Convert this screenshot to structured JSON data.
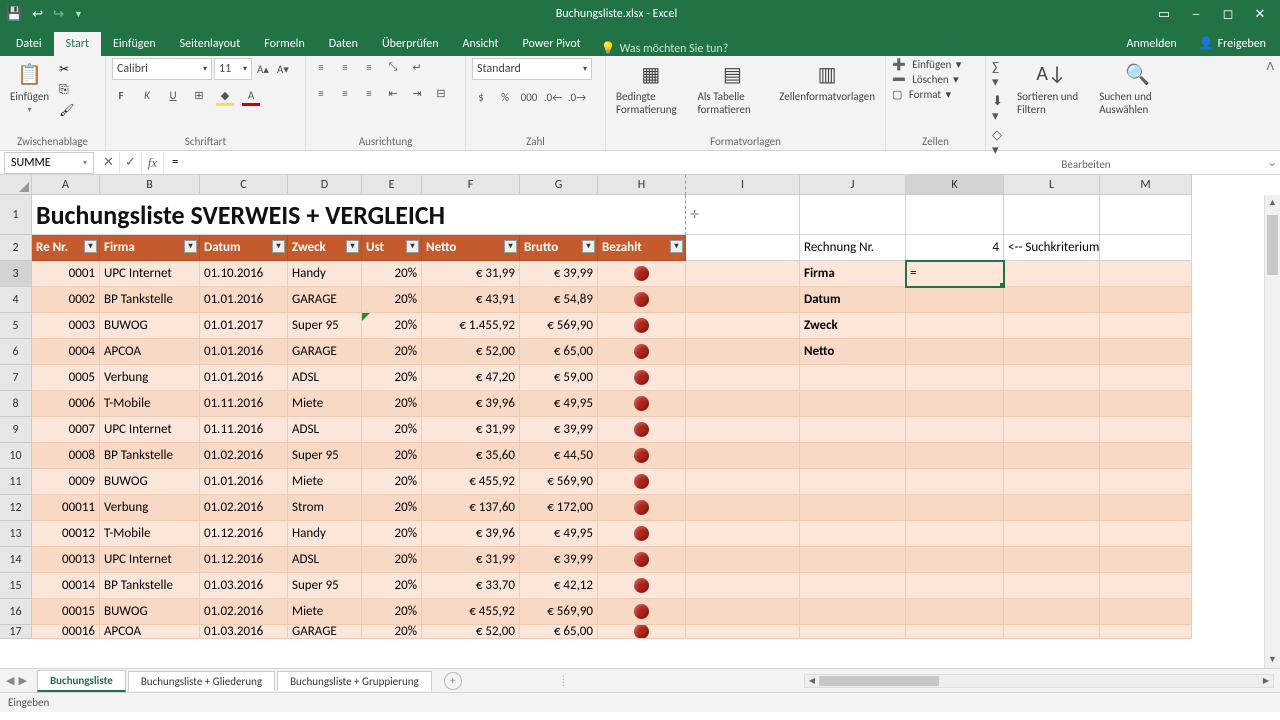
{
  "titlebar": {
    "title": "Buchungsliste.xlsx - Excel"
  },
  "tabs": {
    "file": "Datei",
    "t0": "Start",
    "t1": "Einfügen",
    "t2": "Seitenlayout",
    "t3": "Formeln",
    "t4": "Daten",
    "t5": "Überprüfen",
    "t6": "Ansicht",
    "t7": "Power Pivot",
    "tell": "Was möchten Sie tun?",
    "signin": "Anmelden",
    "share": "Freigeben"
  },
  "ribbon": {
    "clipboard": "Zwischenablage",
    "paste": "Einfügen",
    "font_group": "Schriftart",
    "font": "Calibri",
    "size": "11",
    "align": "Ausrichtung",
    "number": "Zahl",
    "numfmt": "Standard",
    "styles": "Formatvorlagen",
    "cond": "Bedingte Formatierung",
    "astable": "Als Tabelle formatieren",
    "cellstyles": "Zellenformatvorlagen",
    "cells": "Zellen",
    "insert": "Einfügen",
    "delete": "Löschen",
    "format": "Format",
    "editing": "Bearbeiten",
    "sortfilter": "Sortieren und Filtern",
    "findselect": "Suchen und Auswählen"
  },
  "fbar": {
    "name": "SUMME",
    "formula": "="
  },
  "cols": {
    "A": "A",
    "B": "B",
    "C": "C",
    "D": "D",
    "E": "E",
    "F": "F",
    "G": "G",
    "H": "H",
    "I": "I",
    "J": "J",
    "K": "K",
    "L": "L",
    "M": "M"
  },
  "sheet_title": "Buchungsliste SVERWEIS + VERGLEICH",
  "headers": {
    "a": "Re Nr.",
    "b": "Firma",
    "c": "Datum",
    "d": "Zweck",
    "e": "Ust",
    "f": "Netto",
    "g": "Brutto",
    "h": "Bezahlt"
  },
  "lookup": {
    "rnr_label": "Rechnung Nr.",
    "rnr_val": "4",
    "hint": "<-- Suchkriterium",
    "firma": "Firma",
    "datum": "Datum",
    "zweck": "Zweck",
    "netto": "Netto",
    "active": "="
  },
  "rows": [
    {
      "n": "3",
      "a": "0001",
      "b": "UPC Internet",
      "c": "01.10.2016",
      "d": "Handy",
      "e": "20%",
      "f": "€      31,99",
      "g": "€ 39,99"
    },
    {
      "n": "4",
      "a": "0002",
      "b": "BP Tankstelle",
      "c": "01.01.2016",
      "d": "GARAGE",
      "e": "20%",
      "f": "€      43,91",
      "g": "€ 54,89"
    },
    {
      "n": "5",
      "a": "0003",
      "b": "BUWOG",
      "c": "01.01.2017",
      "d": "Super 95",
      "e": "20%",
      "f": "€ 1.455,92",
      "g": "€ 569,90",
      "tri": true
    },
    {
      "n": "6",
      "a": "0004",
      "b": "APCOA",
      "c": "01.01.2016",
      "d": "GARAGE",
      "e": "20%",
      "f": "€      52,00",
      "g": "€ 65,00"
    },
    {
      "n": "7",
      "a": "0005",
      "b": "Verbung",
      "c": "01.01.2016",
      "d": "ADSL",
      "e": "20%",
      "f": "€      47,20",
      "g": "€ 59,00"
    },
    {
      "n": "8",
      "a": "0006",
      "b": "T-Mobile",
      "c": "01.11.2016",
      "d": "Miete",
      "e": "20%",
      "f": "€      39,96",
      "g": "€ 49,95"
    },
    {
      "n": "9",
      "a": "0007",
      "b": "UPC Internet",
      "c": "01.11.2016",
      "d": "ADSL",
      "e": "20%",
      "f": "€      31,99",
      "g": "€ 39,99"
    },
    {
      "n": "10",
      "a": "0008",
      "b": "BP Tankstelle",
      "c": "01.02.2016",
      "d": "Super 95",
      "e": "20%",
      "f": "€      35,60",
      "g": "€ 44,50"
    },
    {
      "n": "11",
      "a": "0009",
      "b": "BUWOG",
      "c": "01.01.2016",
      "d": "Miete",
      "e": "20%",
      "f": "€    455,92",
      "g": "€ 569,90"
    },
    {
      "n": "12",
      "a": "00011",
      "b": "Verbung",
      "c": "01.02.2016",
      "d": "Strom",
      "e": "20%",
      "f": "€    137,60",
      "g": "€ 172,00"
    },
    {
      "n": "13",
      "a": "00012",
      "b": "T-Mobile",
      "c": "01.12.2016",
      "d": "Handy",
      "e": "20%",
      "f": "€      39,96",
      "g": "€ 49,95"
    },
    {
      "n": "14",
      "a": "00013",
      "b": "UPC Internet",
      "c": "01.12.2016",
      "d": "ADSL",
      "e": "20%",
      "f": "€      31,99",
      "g": "€ 39,99"
    },
    {
      "n": "15",
      "a": "00014",
      "b": "BP Tankstelle",
      "c": "01.03.2016",
      "d": "Super 95",
      "e": "20%",
      "f": "€      33,70",
      "g": "€ 42,12"
    },
    {
      "n": "16",
      "a": "00015",
      "b": "BUWOG",
      "c": "01.02.2016",
      "d": "Miete",
      "e": "20%",
      "f": "€    455,92",
      "g": "€ 569,90"
    },
    {
      "n": "17",
      "a": "00016",
      "b": "APCOA",
      "c": "01.03.2016",
      "d": "GARAGE",
      "e": "20%",
      "f": "€      52,00",
      "g": "€ 65,00",
      "partial": true
    }
  ],
  "sheets": {
    "s0": "Buchungsliste",
    "s1": "Buchungsliste + Gliederung",
    "s2": "Buchungsliste + Gruppierung"
  },
  "status": "Eingeben"
}
